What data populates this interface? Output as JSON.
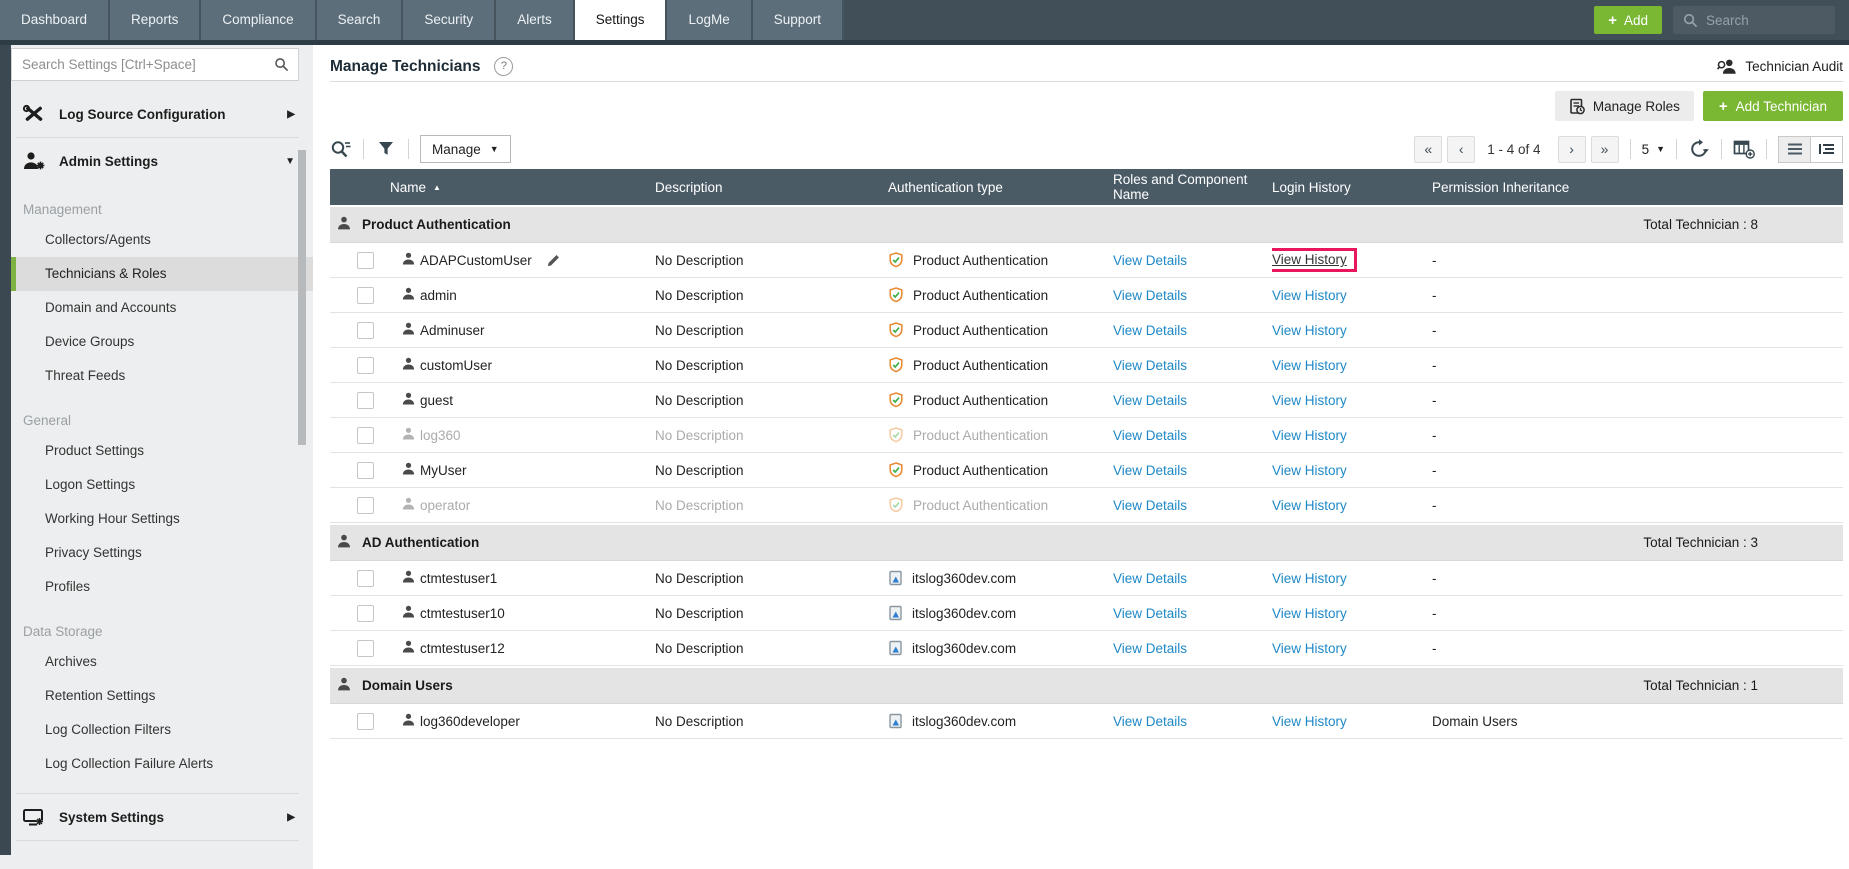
{
  "navbar": {
    "tabs": [
      {
        "label": "Dashboard",
        "active": false
      },
      {
        "label": "Reports",
        "active": false
      },
      {
        "label": "Compliance",
        "active": false
      },
      {
        "label": "Search",
        "active": false
      },
      {
        "label": "Security",
        "active": false
      },
      {
        "label": "Alerts",
        "active": false
      },
      {
        "label": "Settings",
        "active": true
      },
      {
        "label": "LogMe",
        "active": false
      },
      {
        "label": "Support",
        "active": false
      }
    ],
    "add_button_label": "Add",
    "search_placeholder": "Search"
  },
  "sidebar": {
    "search_placeholder": "Search Settings [Ctrl+Space]",
    "top_group_label": "Log Source Configuration",
    "admin_group_label": "Admin Settings",
    "sections": [
      {
        "title": "Management",
        "items": [
          {
            "label": "Collectors/Agents",
            "selected": false
          },
          {
            "label": "Technicians & Roles",
            "selected": true
          },
          {
            "label": "Domain and Accounts",
            "selected": false
          },
          {
            "label": "Device Groups",
            "selected": false
          },
          {
            "label": "Threat Feeds",
            "selected": false
          }
        ]
      },
      {
        "title": "General",
        "items": [
          {
            "label": "Product Settings",
            "selected": false
          },
          {
            "label": "Logon Settings",
            "selected": false
          },
          {
            "label": "Working Hour Settings",
            "selected": false
          },
          {
            "label": "Privacy Settings",
            "selected": false
          },
          {
            "label": "Profiles",
            "selected": false
          }
        ]
      },
      {
        "title": "Data Storage",
        "items": [
          {
            "label": "Archives",
            "selected": false
          },
          {
            "label": "Retention Settings",
            "selected": false
          },
          {
            "label": "Log Collection Filters",
            "selected": false
          },
          {
            "label": "Log Collection Failure Alerts",
            "selected": false
          }
        ]
      }
    ],
    "bottom_group_label": "System Settings"
  },
  "header": {
    "title": "Manage Technicians",
    "audit_label": "Technician Audit"
  },
  "actions": {
    "manage_roles_label": "Manage Roles",
    "add_technician_label": "Add Technician"
  },
  "toolbar": {
    "manage_label": "Manage",
    "pagination_text": "1 - 4 of 4",
    "page_size": "5"
  },
  "table": {
    "columns": [
      "Name",
      "Description",
      "Authentication type",
      "Roles and Component Name",
      "Login History",
      "Permission Inheritance"
    ],
    "view_details_label": "View Details",
    "view_history_label": "View History",
    "groups": [
      {
        "name": "Product Authentication",
        "total": "Total Technician : 8",
        "rows": [
          {
            "name": "ADAPCustomUser",
            "description": "No Description",
            "auth": "Product Authentication",
            "auth_icon": "product",
            "permission": "-",
            "editable": true,
            "highlight_history": true,
            "disabled": false
          },
          {
            "name": "admin",
            "description": "No Description",
            "auth": "Product Authentication",
            "auth_icon": "product",
            "permission": "-",
            "editable": false,
            "highlight_history": false,
            "disabled": false
          },
          {
            "name": "Adminuser",
            "description": "No Description",
            "auth": "Product Authentication",
            "auth_icon": "product",
            "permission": "-",
            "editable": false,
            "highlight_history": false,
            "disabled": false
          },
          {
            "name": "customUser",
            "description": "No Description",
            "auth": "Product Authentication",
            "auth_icon": "product",
            "permission": "-",
            "editable": false,
            "highlight_history": false,
            "disabled": false
          },
          {
            "name": "guest",
            "description": "No Description",
            "auth": "Product Authentication",
            "auth_icon": "product",
            "permission": "-",
            "editable": false,
            "highlight_history": false,
            "disabled": false
          },
          {
            "name": "log360",
            "description": "No Description",
            "auth": "Product Authentication",
            "auth_icon": "product",
            "permission": "-",
            "editable": false,
            "highlight_history": false,
            "disabled": true
          },
          {
            "name": "MyUser",
            "description": "No Description",
            "auth": "Product Authentication",
            "auth_icon": "product",
            "permission": "-",
            "editable": false,
            "highlight_history": false,
            "disabled": false
          },
          {
            "name": "operator",
            "description": "No Description",
            "auth": "Product Authentication",
            "auth_icon": "product",
            "permission": "-",
            "editable": false,
            "highlight_history": false,
            "disabled": true
          }
        ]
      },
      {
        "name": "AD Authentication",
        "total": "Total Technician : 3",
        "rows": [
          {
            "name": "ctmtestuser1",
            "description": "No Description",
            "auth": "itslog360dev.com",
            "auth_icon": "ad",
            "permission": "-",
            "editable": false,
            "highlight_history": false,
            "disabled": false
          },
          {
            "name": "ctmtestuser10",
            "description": "No Description",
            "auth": "itslog360dev.com",
            "auth_icon": "ad",
            "permission": "-",
            "editable": false,
            "highlight_history": false,
            "disabled": false
          },
          {
            "name": "ctmtestuser12",
            "description": "No Description",
            "auth": "itslog360dev.com",
            "auth_icon": "ad",
            "permission": "-",
            "editable": false,
            "highlight_history": false,
            "disabled": false
          }
        ]
      },
      {
        "name": "Domain Users",
        "total": "Total Technician : 1",
        "rows": [
          {
            "name": "log360developer",
            "description": "No Description",
            "auth": "itslog360dev.com",
            "auth_icon": "ad",
            "permission": "Domain Users",
            "editable": false,
            "highlight_history": false,
            "disabled": false
          }
        ]
      }
    ]
  },
  "colors": {
    "nav_bg": "#414f59",
    "tab_bg": "#5b6e7a",
    "accent_green": "#7ab733",
    "link_blue": "#1e88c7",
    "table_header_bg": "#4b5b66",
    "highlight_red": "#e8175d",
    "selected_green_bar": "#7cb342"
  }
}
